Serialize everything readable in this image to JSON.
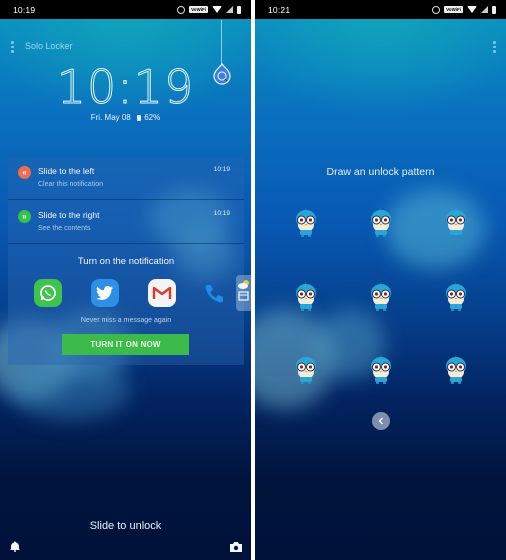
{
  "left_screen": {
    "status_bar": {
      "time": "10:19",
      "vowifi_label": "VoWiFi"
    },
    "app_title": "Solo Locker",
    "clock": "10:19",
    "date": "Fri. May 08",
    "battery": "62%",
    "notifications": [
      {
        "title": "Slide to the left",
        "subtitle": "Clear this notification",
        "time": "10:19",
        "badge_glyph": "«",
        "badge_color": "#f26b50"
      },
      {
        "title": "Slide to the right",
        "subtitle": "See the contents",
        "time": "10:19",
        "badge_glyph": "»",
        "badge_color": "#35c24a"
      }
    ],
    "turn_on_card": {
      "title": "Turn on the notification",
      "apps": [
        "WhatsApp",
        "Twitter",
        "Gmail",
        "Phone"
      ],
      "message": "Never miss a message again",
      "button_label": "TURN IT ON NOW",
      "button_color": "#3cba4a"
    },
    "slide_to_unlock": "Slide to unlock"
  },
  "right_screen": {
    "status_bar": {
      "time": "10:21",
      "vowifi_label": "VoWiFi"
    },
    "pattern_prompt": "Draw an unlock pattern",
    "pattern_nodes": 9
  }
}
